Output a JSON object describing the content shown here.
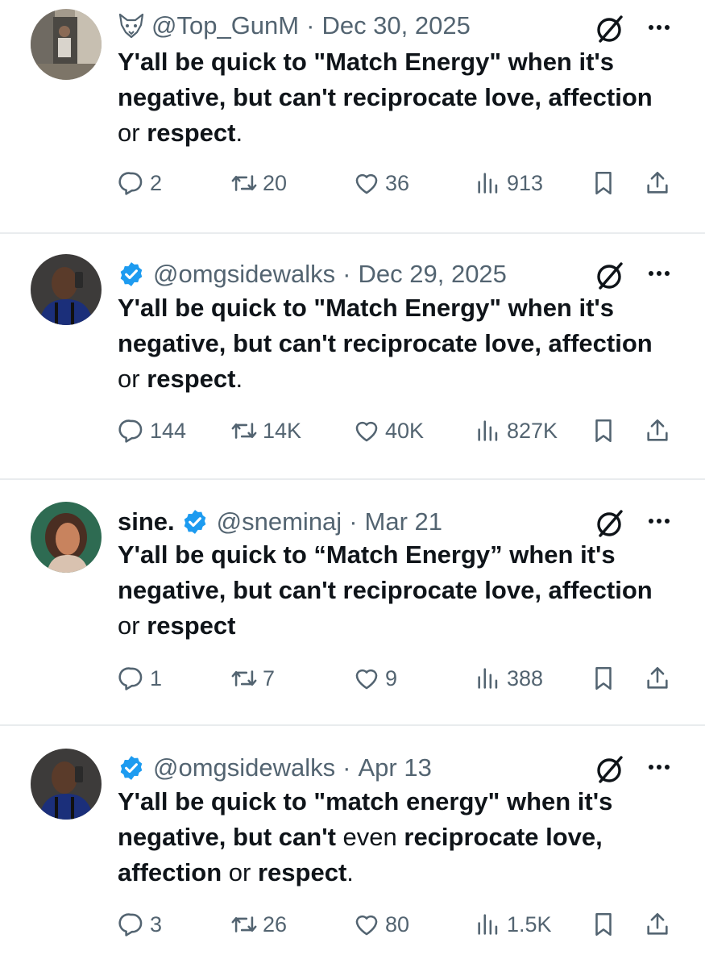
{
  "tweets": [
    {
      "name": "",
      "handle_icon": "fox-icon",
      "verified": false,
      "handle": "@Top_GunM",
      "date": "Dec 30, 2025",
      "text": [
        {
          "t": "Y'all be quick to \"Match Energy\" when it's negative, but can't reciprocate love, affection",
          "b": true
        },
        {
          "t": " or ",
          "b": false
        },
        {
          "t": "respect",
          "b": true
        },
        {
          "t": ".",
          "b": false
        }
      ],
      "replies": "2",
      "retweets": "20",
      "likes": "36",
      "views": "913"
    },
    {
      "name": "",
      "handle_icon": "",
      "verified": true,
      "handle": "@omgsidewalks",
      "date": "Dec 29, 2025",
      "text": [
        {
          "t": "Y'all be quick to \"Match Energy\" when it's negative, but can't reciprocate love, affection",
          "b": true
        },
        {
          "t": " or ",
          "b": false
        },
        {
          "t": "respect",
          "b": true
        },
        {
          "t": ".",
          "b": false
        }
      ],
      "replies": "144",
      "retweets": "14K",
      "likes": "40K",
      "views": "827K"
    },
    {
      "name": "sine.",
      "handle_icon": "",
      "verified": true,
      "handle": "@sneminaj",
      "date": "Mar 21",
      "text": [
        {
          "t": "Y'all be quick to “Match Energy” when it's negative, but can't reciprocate love, affection",
          "b": true
        },
        {
          "t": " or ",
          "b": false
        },
        {
          "t": "respect",
          "b": true
        }
      ],
      "replies": "1",
      "retweets": "7",
      "likes": "9",
      "views": "388"
    },
    {
      "name": "",
      "handle_icon": "",
      "verified": true,
      "handle": "@omgsidewalks",
      "date": "Apr 13",
      "text": [
        {
          "t": "Y'all be quick to \"match energy\" when it's negative, but can't",
          "b": true
        },
        {
          "t": " even ",
          "b": false
        },
        {
          "t": "reciprocate love, affection",
          "b": true
        },
        {
          "t": " or ",
          "b": false
        },
        {
          "t": "respect",
          "b": true
        },
        {
          "t": ".",
          "b": false
        }
      ],
      "replies": "3",
      "retweets": "26",
      "likes": "80",
      "views": "1.5K"
    }
  ],
  "separator": "·",
  "colors": {
    "text": "#0f1419",
    "secondary": "#536471",
    "verified": "#1d9bf0",
    "divider": "#e9ecee"
  },
  "icons": {
    "reply": "speech-bubble-icon",
    "retweet": "retweet-arrows-icon",
    "like": "heart-icon",
    "views": "bar-chart-icon",
    "bookmark": "bookmark-icon",
    "share": "share-upload-icon",
    "grok": "grok-slash-circle-icon",
    "more": "more-dots-icon"
  }
}
